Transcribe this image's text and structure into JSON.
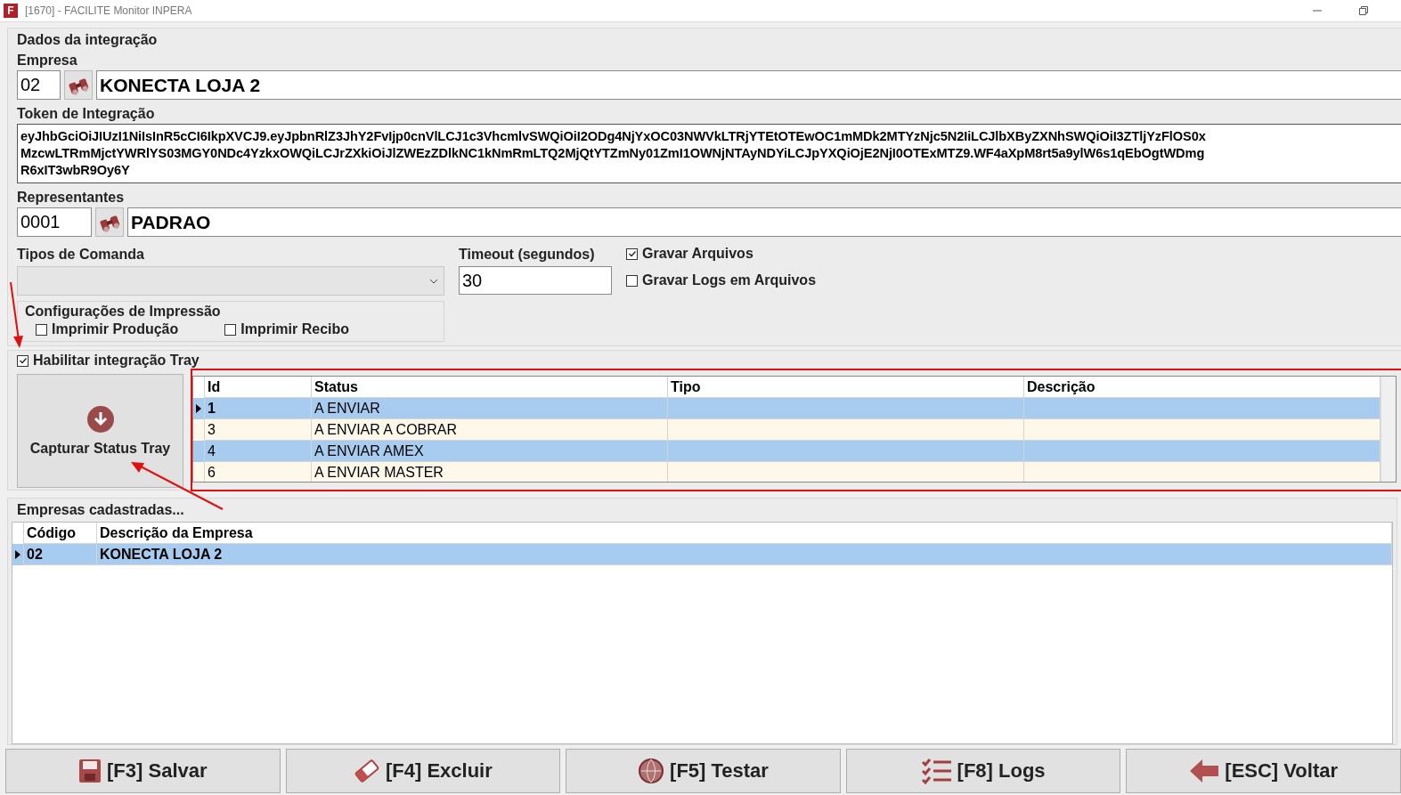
{
  "window": {
    "app_icon_letter": "F",
    "title": "[1670] - FACILITE Monitor INPERA"
  },
  "integration": {
    "group_title": "Dados da integração",
    "empresa": {
      "label": "Empresa",
      "code": "02",
      "name": "KONECTA LOJA 2"
    },
    "token": {
      "label": "Token de Integração",
      "lines": [
        "eyJhbGciOiJIUzI1NiIsInR5cCI6IkpXVCJ9.eyJpbnRlZ3JhY2FvIjp0cnVlLCJ1c3VhcmlvSWQiOiI2ODg4NjYxOC03NWVkLTRjYTEtOTEwOC1mMDk2MTYzNjc5N2IiLCJlbXByZXNhSWQiOiI3ZTljYzFlOS0x",
        "MzcwLTRmMjctYWRlYS03MGY0NDc4YzkxOWQiLCJrZXkiOiJlZWEzZDlkNC1kNmRmLTQ2MjQtYTZmNy01ZmI1OWNjNTAyNDYiLCJpYXQiOjE2NjI0OTExMTZ9.WF4aXpM8rt5a9ylW6s1qEbOgtWDmg",
        "R6xIT3wbR9Oy6Y"
      ]
    },
    "representantes": {
      "label": "Representantes",
      "code": "0001",
      "name": "PADRAO"
    },
    "tipos_comanda": {
      "label": "Tipos de Comanda"
    },
    "timeout": {
      "label": "Timeout (segundos)",
      "value": "30"
    },
    "options": [
      {
        "label": "Gravar Arquivos",
        "checked": true
      },
      {
        "label": "Gravar Logs em Arquivos",
        "checked": false
      }
    ],
    "impressao": {
      "title": "Configurações de Impressão",
      "options": [
        {
          "label": "Imprimir Produção",
          "checked": false
        },
        {
          "label": "Imprimir Recibo",
          "checked": false
        }
      ]
    }
  },
  "tray": {
    "enable": {
      "label": "Habilitar integração Tray",
      "checked": true
    },
    "capture_button": "Capturar Status Tray",
    "table": {
      "columns": [
        "Id",
        "Status",
        "Tipo",
        "Descrição"
      ],
      "rows": [
        {
          "cells": [
            "1",
            "A ENVIAR",
            "",
            ""
          ],
          "selected": true,
          "current": true
        },
        {
          "cells": [
            "3",
            "A ENVIAR A COBRAR",
            "",
            ""
          ],
          "selected": false,
          "current": false
        },
        {
          "cells": [
            "4",
            "A ENVIAR AMEX",
            "",
            ""
          ],
          "selected": true,
          "current": false
        },
        {
          "cells": [
            "6",
            "A ENVIAR MASTER",
            "",
            ""
          ],
          "selected": false,
          "current": false
        }
      ]
    }
  },
  "empresas": {
    "title": "Empresas cadastradas...",
    "columns": [
      "Código",
      "Descrição da Empresa"
    ],
    "rows": [
      {
        "cells": [
          "02",
          "KONECTA LOJA 2"
        ],
        "selected": true,
        "current": true
      }
    ]
  },
  "buttons": [
    {
      "kind": "save",
      "label": "[F3] Salvar"
    },
    {
      "kind": "delete",
      "label": "[F4] Excluir"
    },
    {
      "kind": "test",
      "label": "[F5] Testar"
    },
    {
      "kind": "logs",
      "label": "[F8] Logs"
    },
    {
      "kind": "back",
      "label": "[ESC] Voltar"
    }
  ]
}
